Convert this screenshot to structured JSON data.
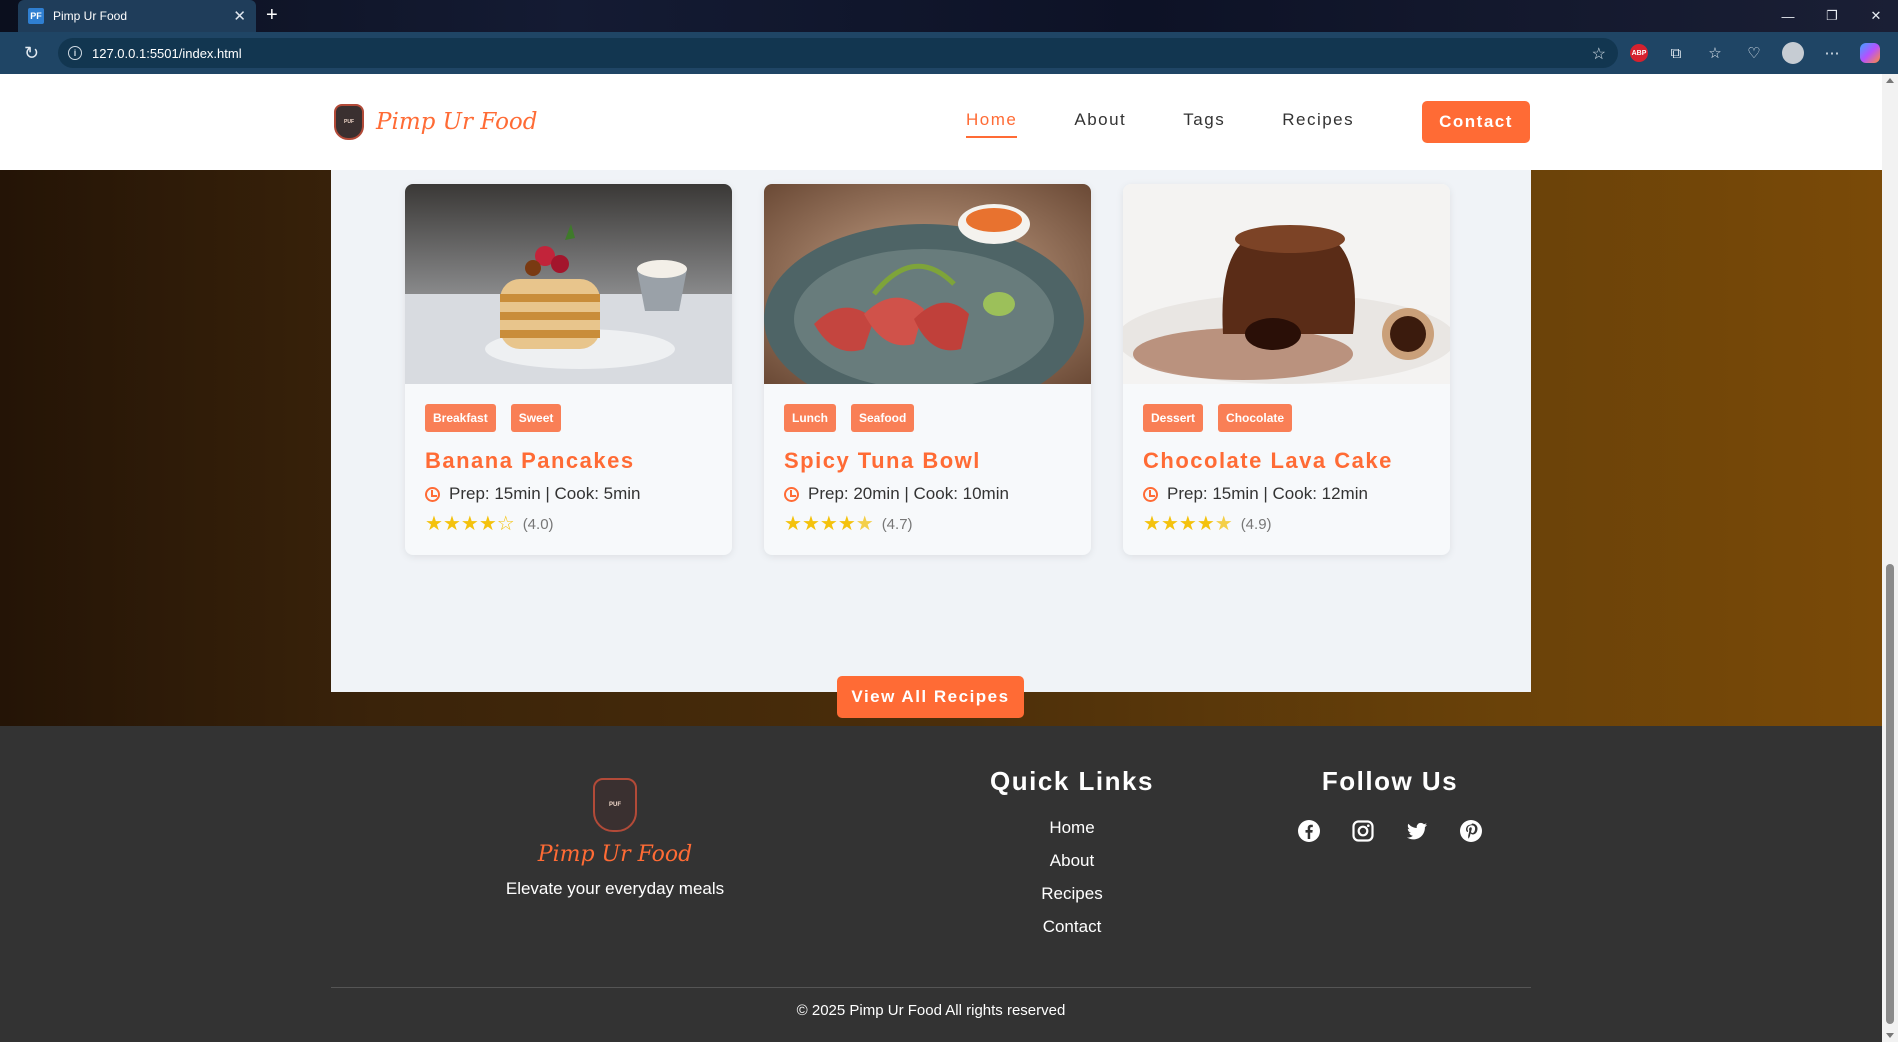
{
  "browser": {
    "tab_title": "Pimp Ur Food",
    "tab_favicon": "PF",
    "url": "127.0.0.1:5501/index.html"
  },
  "nav": {
    "brand": "Pimp Ur Food",
    "links": [
      "Home",
      "About",
      "Tags",
      "Recipes"
    ],
    "active": "Home",
    "contact": "Contact"
  },
  "recipes": [
    {
      "title": "Banana Pancakes",
      "tags": [
        "Breakfast",
        "Sweet"
      ],
      "meta": "Prep: 15min | Cook: 5min",
      "rating": 4.0,
      "rating_text": "(4.0)"
    },
    {
      "title": "Spicy Tuna Bowl",
      "tags": [
        "Lunch",
        "Seafood"
      ],
      "meta": "Prep: 20min | Cook: 10min",
      "rating": 4.7,
      "rating_text": "(4.7)"
    },
    {
      "title": "Chocolate Lava Cake",
      "tags": [
        "Dessert",
        "Chocolate"
      ],
      "meta": "Prep: 15min | Cook: 12min",
      "rating": 4.9,
      "rating_text": "(4.9)"
    }
  ],
  "view_all": "View All Recipes",
  "footer": {
    "brand": "Pimp Ur Food",
    "tagline": "Elevate your everyday meals",
    "quick_links_heading": "Quick Links",
    "quick_links": [
      "Home",
      "About",
      "Recipes",
      "Contact"
    ],
    "follow_heading": "Follow Us",
    "socials": [
      "facebook-icon",
      "instagram-icon",
      "twitter-icon",
      "pinterest-icon"
    ],
    "copyright": "© 2025 Pimp Ur Food All rights reserved"
  },
  "colors": {
    "accent": "#ff6b35",
    "tag": "#f97f56",
    "star": "#f4c20d",
    "footer_bg": "#333333"
  }
}
